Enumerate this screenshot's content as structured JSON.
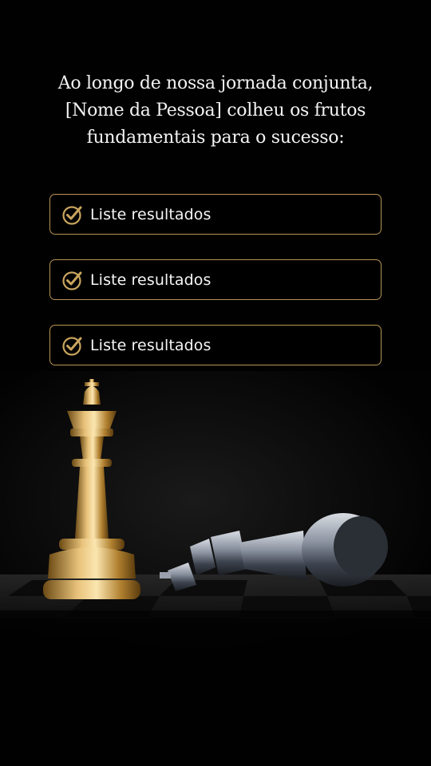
{
  "headline": "Ao longo de nossa jornada conjunta, [Nome da Pessoa] colheu os frutos fundamentais para o sucesso:",
  "results": [
    {
      "label": "Liste resultados",
      "icon": "check-circle-icon"
    },
    {
      "label": "Liste resultados",
      "icon": "check-circle-icon"
    },
    {
      "label": "Liste resultados",
      "icon": "check-circle-icon"
    }
  ],
  "colors": {
    "background": "#010101",
    "accent_gold": "#b89455",
    "text": "#f5f5f5"
  },
  "illustration": {
    "gold_piece": "chess-king-gold-icon",
    "silver_piece": "chess-king-fallen-silver-icon",
    "board": "chessboard"
  }
}
